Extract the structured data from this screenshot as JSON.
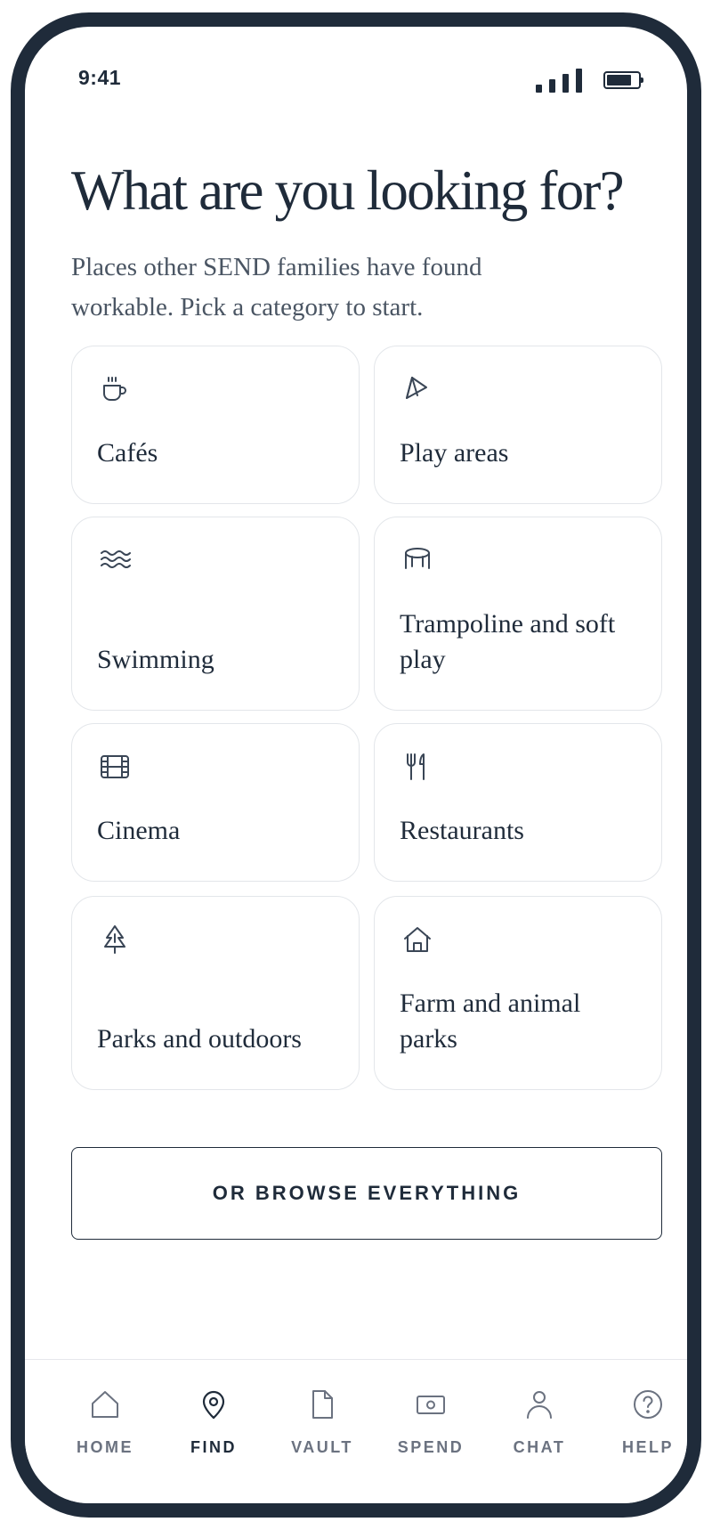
{
  "status_bar": {
    "time": "9:41"
  },
  "header": {
    "title": "What are you looking for?",
    "subtitle": "Places other SEND families have found workable. Pick a category to start."
  },
  "categories": [
    {
      "label": "Cafés",
      "icon": "coffee-cup-icon"
    },
    {
      "label": "Play areas",
      "icon": "kite-icon"
    },
    {
      "label": "Swimming",
      "icon": "waves-icon"
    },
    {
      "label": "Trampoline and soft play",
      "icon": "trampoline-icon"
    },
    {
      "label": "Cinema",
      "icon": "film-icon"
    },
    {
      "label": "Restaurants",
      "icon": "fork-knife-icon"
    },
    {
      "label": "Parks and outdoors",
      "icon": "tree-icon"
    },
    {
      "label": "Farm and animal parks",
      "icon": "house-icon"
    }
  ],
  "browse_button": {
    "label": "OR BROWSE EVERYTHING"
  },
  "nav": {
    "active": "FIND",
    "items": [
      {
        "label": "HOME",
        "icon": "home-icon"
      },
      {
        "label": "FIND",
        "icon": "map-pin-icon"
      },
      {
        "label": "VAULT",
        "icon": "document-icon"
      },
      {
        "label": "SPEND",
        "icon": "money-icon"
      },
      {
        "label": "CHAT",
        "icon": "person-icon"
      },
      {
        "label": "HELP",
        "icon": "help-circle-icon"
      }
    ]
  },
  "colors": {
    "frame": "#1f2b3a",
    "text": "#1f2b3a",
    "muted": "#6b7280",
    "card_border": "#e3e6ea"
  }
}
